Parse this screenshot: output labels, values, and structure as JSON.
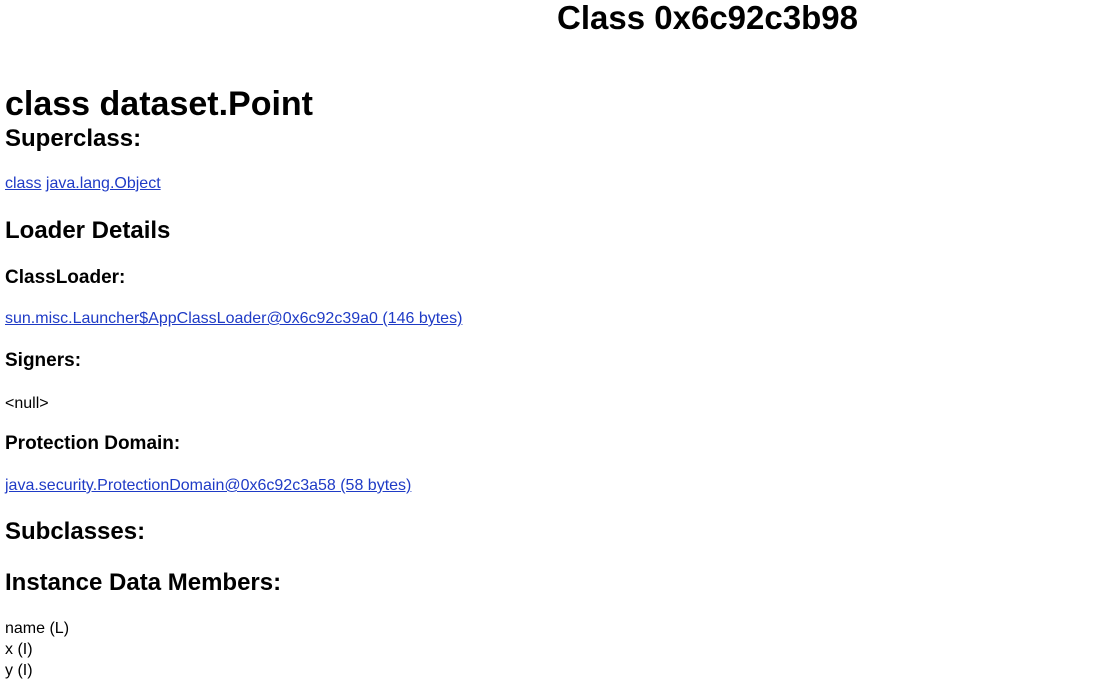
{
  "page": {
    "title": "Class 0x6c92c3b98",
    "class_heading": "class dataset.Point",
    "superclass": {
      "heading": "Superclass:",
      "link_class": "class",
      "link_name": "java.lang.Object"
    },
    "loader_details": {
      "heading": "Loader Details",
      "classloader_heading": "ClassLoader:",
      "classloader_link": "sun.misc.Launcher$AppClassLoader@0x6c92c39a0 (146 bytes)",
      "signers_heading": "Signers:",
      "signers_value": "<null>",
      "protection_heading": "Protection Domain:",
      "protection_link": "java.security.ProtectionDomain@0x6c92c3a58 (58 bytes)"
    },
    "subclasses": {
      "heading": "Subclasses:"
    },
    "instance_members": {
      "heading": "Instance Data Members:",
      "items": [
        "name (L)",
        "x (I)",
        "y (I)"
      ]
    }
  }
}
